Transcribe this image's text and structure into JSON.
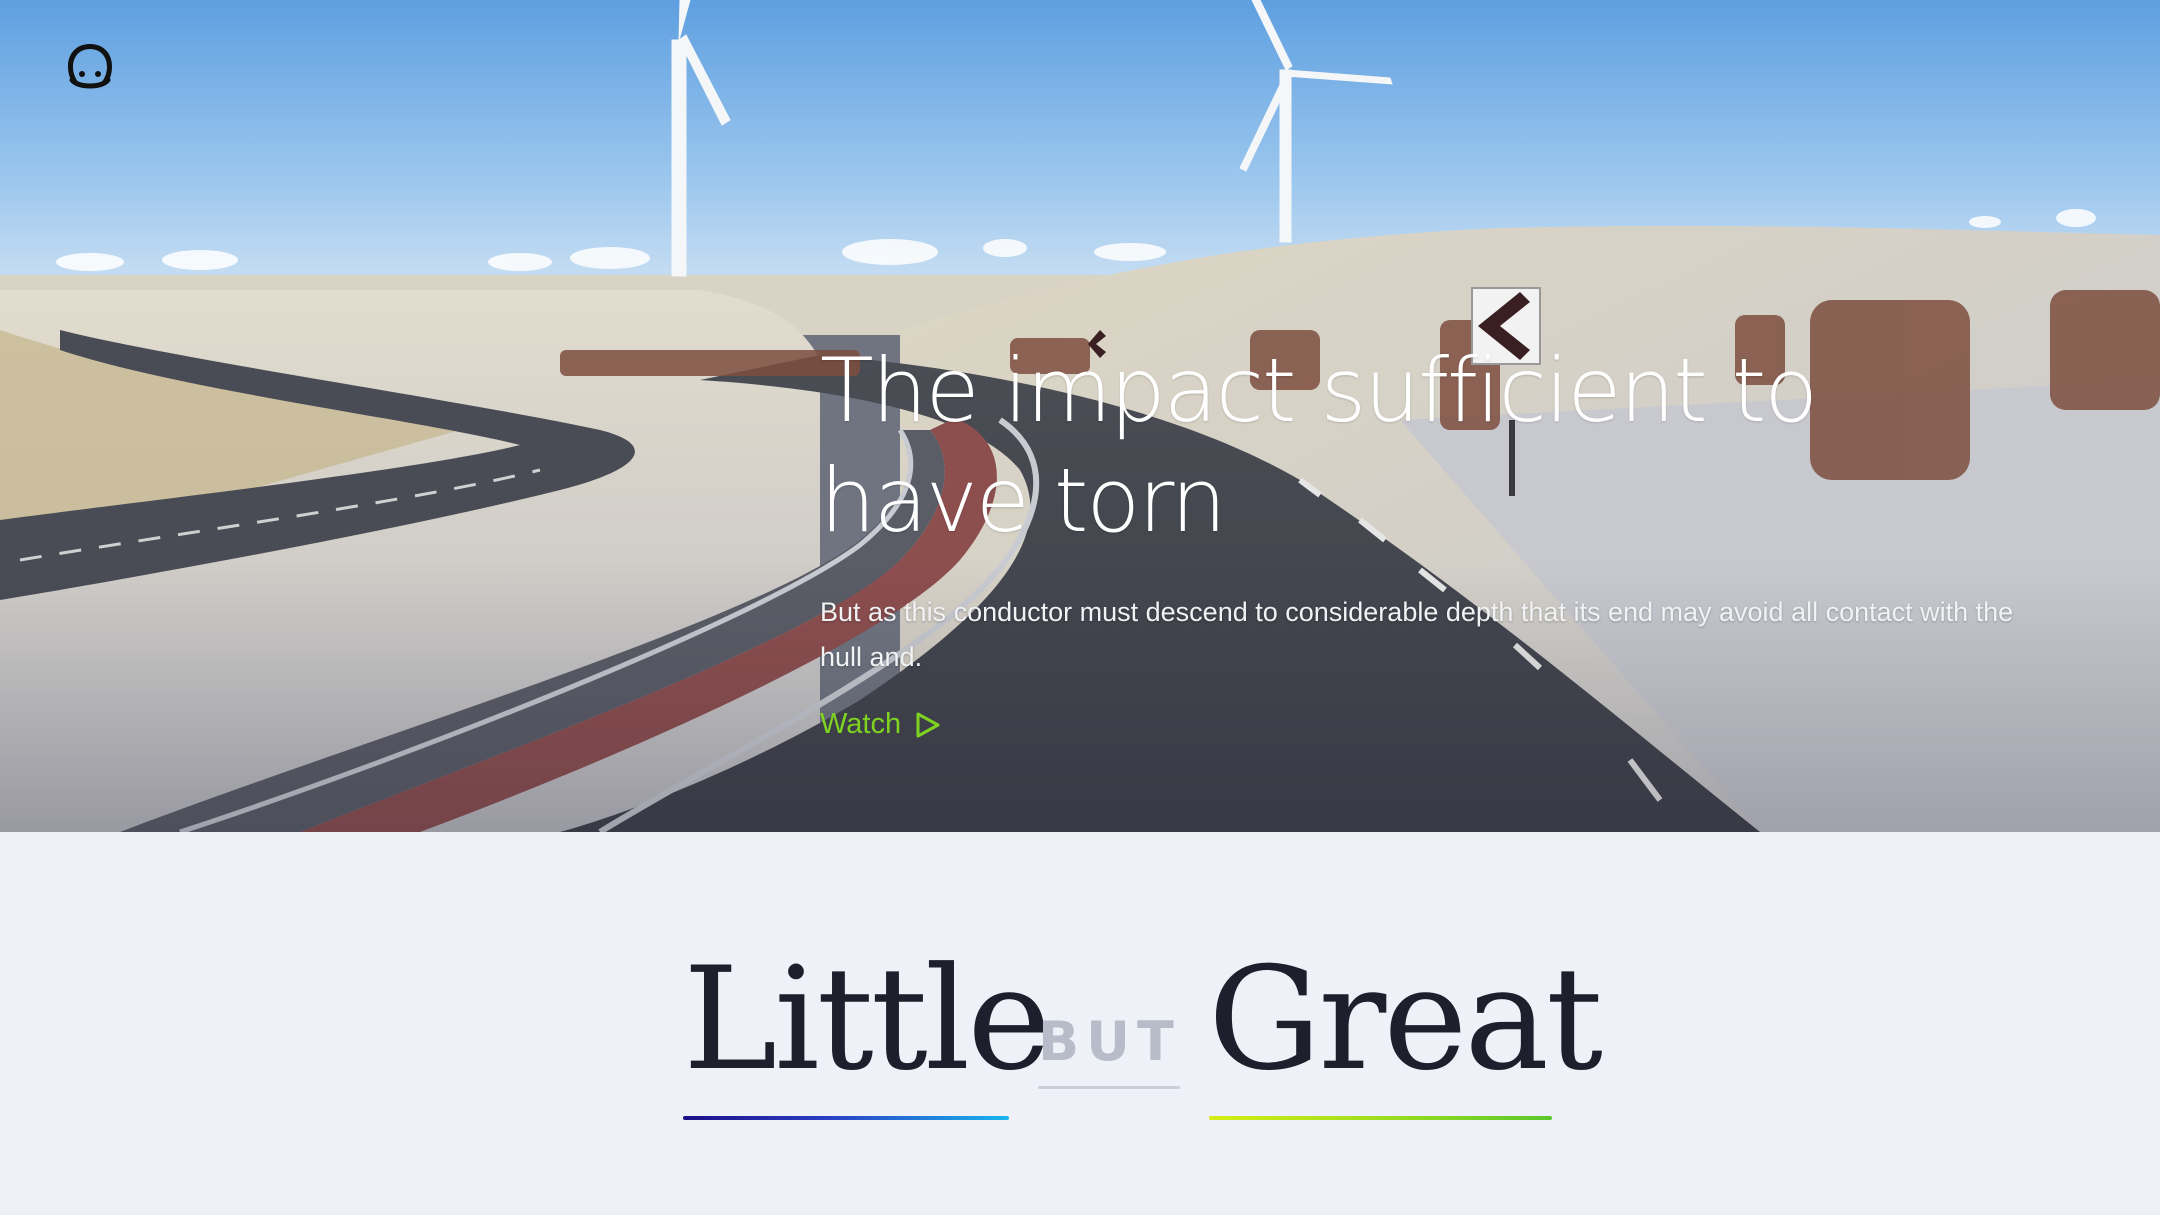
{
  "hero": {
    "title": "The impact sufficient to have torn",
    "description": "But as this conductor must descend to considerable depth that its end may avoid all contact with the hull and.",
    "watch_label": "Watch"
  },
  "tagline": {
    "word1": "Little",
    "connector": "BUT",
    "word2": "Great"
  },
  "icons": {
    "logo": "face-logo-icon",
    "play": "play-outline-icon"
  },
  "colors": {
    "accent_green": "#7ed321",
    "heading_dark": "#1d1f2c",
    "section_bg": "#eef2f8",
    "connector_gray": "#b7bcc8"
  }
}
